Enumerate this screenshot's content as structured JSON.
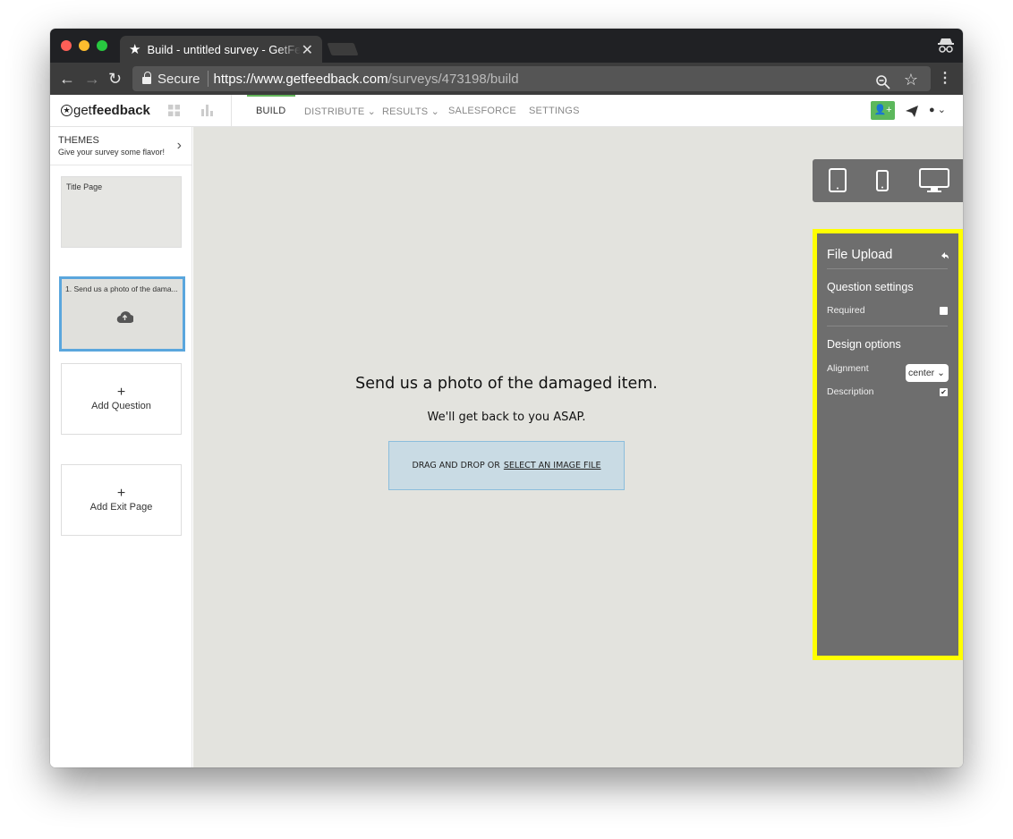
{
  "browser": {
    "tab_title": "Build - untitled survey - GetFeedback",
    "secure_label": "Secure",
    "url_host": "https://www.getfeedback.com",
    "url_path": "/surveys/473198/build"
  },
  "app": {
    "logo_prefix": "get",
    "logo_bold": "feedback",
    "nav": {
      "build": "BUILD",
      "distribute": "DISTRIBUTE",
      "results": "RESULTS",
      "salesforce": "SALESFORCE",
      "settings": "SETTINGS"
    }
  },
  "sidebar": {
    "themes_title": "THEMES",
    "themes_subtitle": "Give your survey some flavor!",
    "title_page": "Title Page",
    "question_card": "1. Send us a photo of the dama...",
    "add_question": "Add Question",
    "add_exit_page": "Add Exit Page",
    "plus": "+"
  },
  "canvas": {
    "question_title": "Send us a photo of the damaged item.",
    "question_description": "We'll get back to you ASAP.",
    "drop_text": "DRAG AND DROP OR",
    "select_link": "SELECT AN IMAGE FILE"
  },
  "panel": {
    "title": "File Upload",
    "question_settings": "Question settings",
    "required_label": "Required",
    "required_checked": false,
    "design_options": "Design options",
    "alignment_label": "Alignment",
    "alignment_value": "center",
    "description_label": "Description",
    "description_checked": true
  },
  "colors": {
    "highlight": "#ffff00",
    "accent_green": "#5cb85c",
    "selected_border": "#5aa6dd",
    "panel_bg": "#6e6e6e"
  }
}
